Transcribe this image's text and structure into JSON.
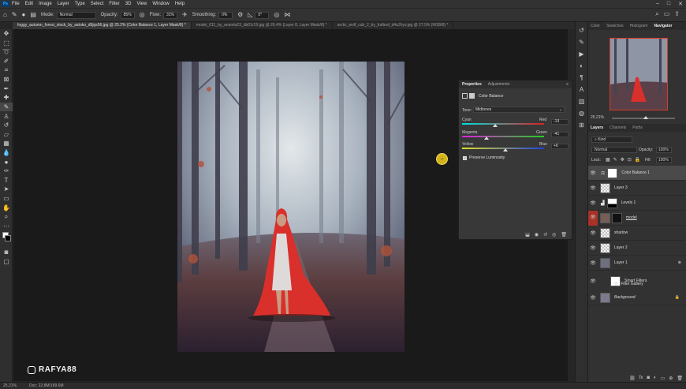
{
  "menu": {
    "items": [
      "File",
      "Edit",
      "Image",
      "Layer",
      "Type",
      "Select",
      "Filter",
      "3D",
      "View",
      "Window",
      "Help"
    ]
  },
  "options": {
    "mode_label": "Mode:",
    "mode_value": "Normal",
    "opacity_label": "Opacity:",
    "opacity_value": "85%",
    "flow_label": "Flow:",
    "flow_value": "31%",
    "smoothing_label": "Smoothing:",
    "smoothing_value": "0%",
    "angle_value": "0°"
  },
  "tabs": [
    {
      "label": "foggy_autumn_forest_stock_by_astoko_d9jqs56.jpg @ 25.2% (Color Balance 1, Layer Mask/8) *"
    },
    {
      "label": "model_011_by_anamla23_db01r19.jpg @ 26.4% (Layer 8, Layer Mask/8) *"
    },
    {
      "label": "arctic_wolf_cub_2_by_furibnd_d4u2hyv.jpg @ 27.5% (RGB/8) *"
    }
  ],
  "properties": {
    "tab_active": "Properties",
    "tab_other": "Adjustments",
    "title": "Color Balance",
    "tone_label": "Tone:",
    "tone_value": "Midtones",
    "cyan": "Cyan",
    "red": "Red",
    "cyan_red_value": "-19",
    "magenta": "Magenta",
    "green": "Green",
    "magenta_green_value": "-41",
    "yellow": "Yellow",
    "blue": "Blue",
    "yellow_blue_value": "+6",
    "preserve_label": "Preserve Luminosity",
    "cyan_red_level": -19,
    "magenta_green_level": -41,
    "yellow_blue_level": 6
  },
  "panels": {
    "top_tabs": [
      "Color",
      "Swatches",
      "Histogram",
      "Navigator"
    ],
    "zoom": "25.21%",
    "layer_tabs": [
      "Layers",
      "Channels",
      "Paths"
    ],
    "kind_label": "Kind",
    "blend_mode": "Normal",
    "opacity_label": "Opacity:",
    "opacity_value": "100%",
    "lock_label": "Lock:",
    "fill_label": "Fill:",
    "fill_value": "100%"
  },
  "layers": [
    {
      "name": "Color Balance 1"
    },
    {
      "name": "Layer 3"
    },
    {
      "name": "Levels 1"
    },
    {
      "name": "model"
    },
    {
      "name": "shadow"
    },
    {
      "name": "Layer 2"
    },
    {
      "name": "Layer 1"
    },
    {
      "name": "Smart Filters"
    },
    {
      "name": "Filter Gallery"
    },
    {
      "name": "Background"
    }
  ],
  "status": {
    "zoom": "25.21%",
    "doc": "Doc: 22.8M/189.6M"
  },
  "watermark": {
    "text": "RAFYA88"
  },
  "colors": {
    "accent": "#31a8ff",
    "cloak": "#d9302c",
    "cursor": "#d4b21c"
  }
}
